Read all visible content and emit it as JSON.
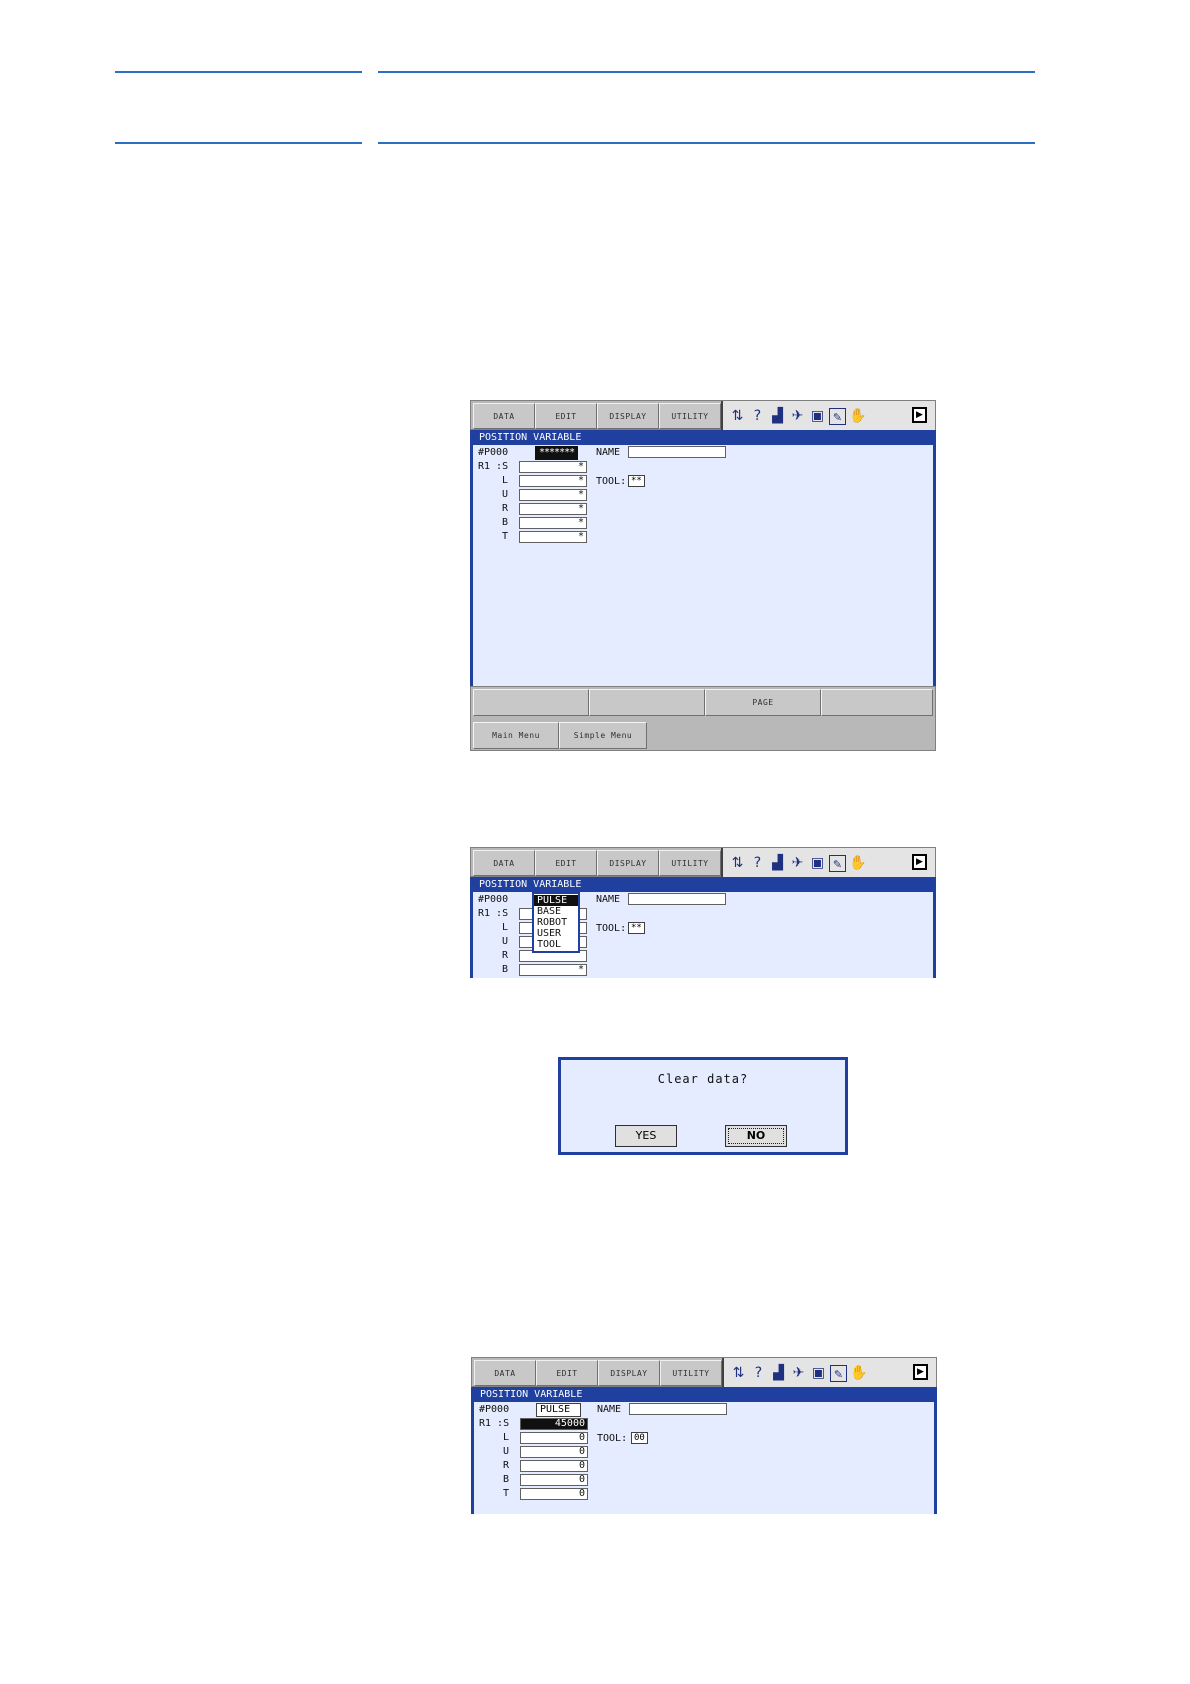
{
  "menu": {
    "data": "DATA",
    "edit": "EDIT",
    "display": "DISPLAY",
    "utility": "UTILITY"
  },
  "window_title": "POSITION VARIABLE",
  "var_no": "#P000",
  "r1_s": "R1 :S",
  "axes": [
    "L",
    "U",
    "R",
    "B",
    "T"
  ],
  "name_label": "NAME",
  "tool_label": "TOOL:",
  "screen1": {
    "type_value": "*******",
    "axis_values": [
      "*",
      "*",
      "*",
      "*",
      "*",
      "*"
    ],
    "tool_value": "**"
  },
  "screen2": {
    "dropdown": [
      "PULSE",
      "BASE",
      "ROBOT",
      "USER",
      "TOOL"
    ],
    "tool_value": "**",
    "last_value": "*"
  },
  "footer": {
    "f3": "PAGE",
    "main_menu": "Main Menu",
    "simple_menu": "Simple Menu"
  },
  "dialog": {
    "message": "Clear data?",
    "yes": "YES",
    "no": "NO"
  },
  "screen3": {
    "type_value": "PULSE",
    "axis_values": [
      "45000",
      "0",
      "0",
      "0",
      "0",
      "0"
    ],
    "tool_value": "00"
  },
  "colors": {
    "accent": "#2040a0",
    "panel": "#e6ecff",
    "rule": "#2a6fc0"
  },
  "icons": [
    "coord-icon",
    "help-icon",
    "signal-icon",
    "speed-icon",
    "job-icon",
    "edit-icon",
    "hand-icon",
    "play-icon"
  ]
}
